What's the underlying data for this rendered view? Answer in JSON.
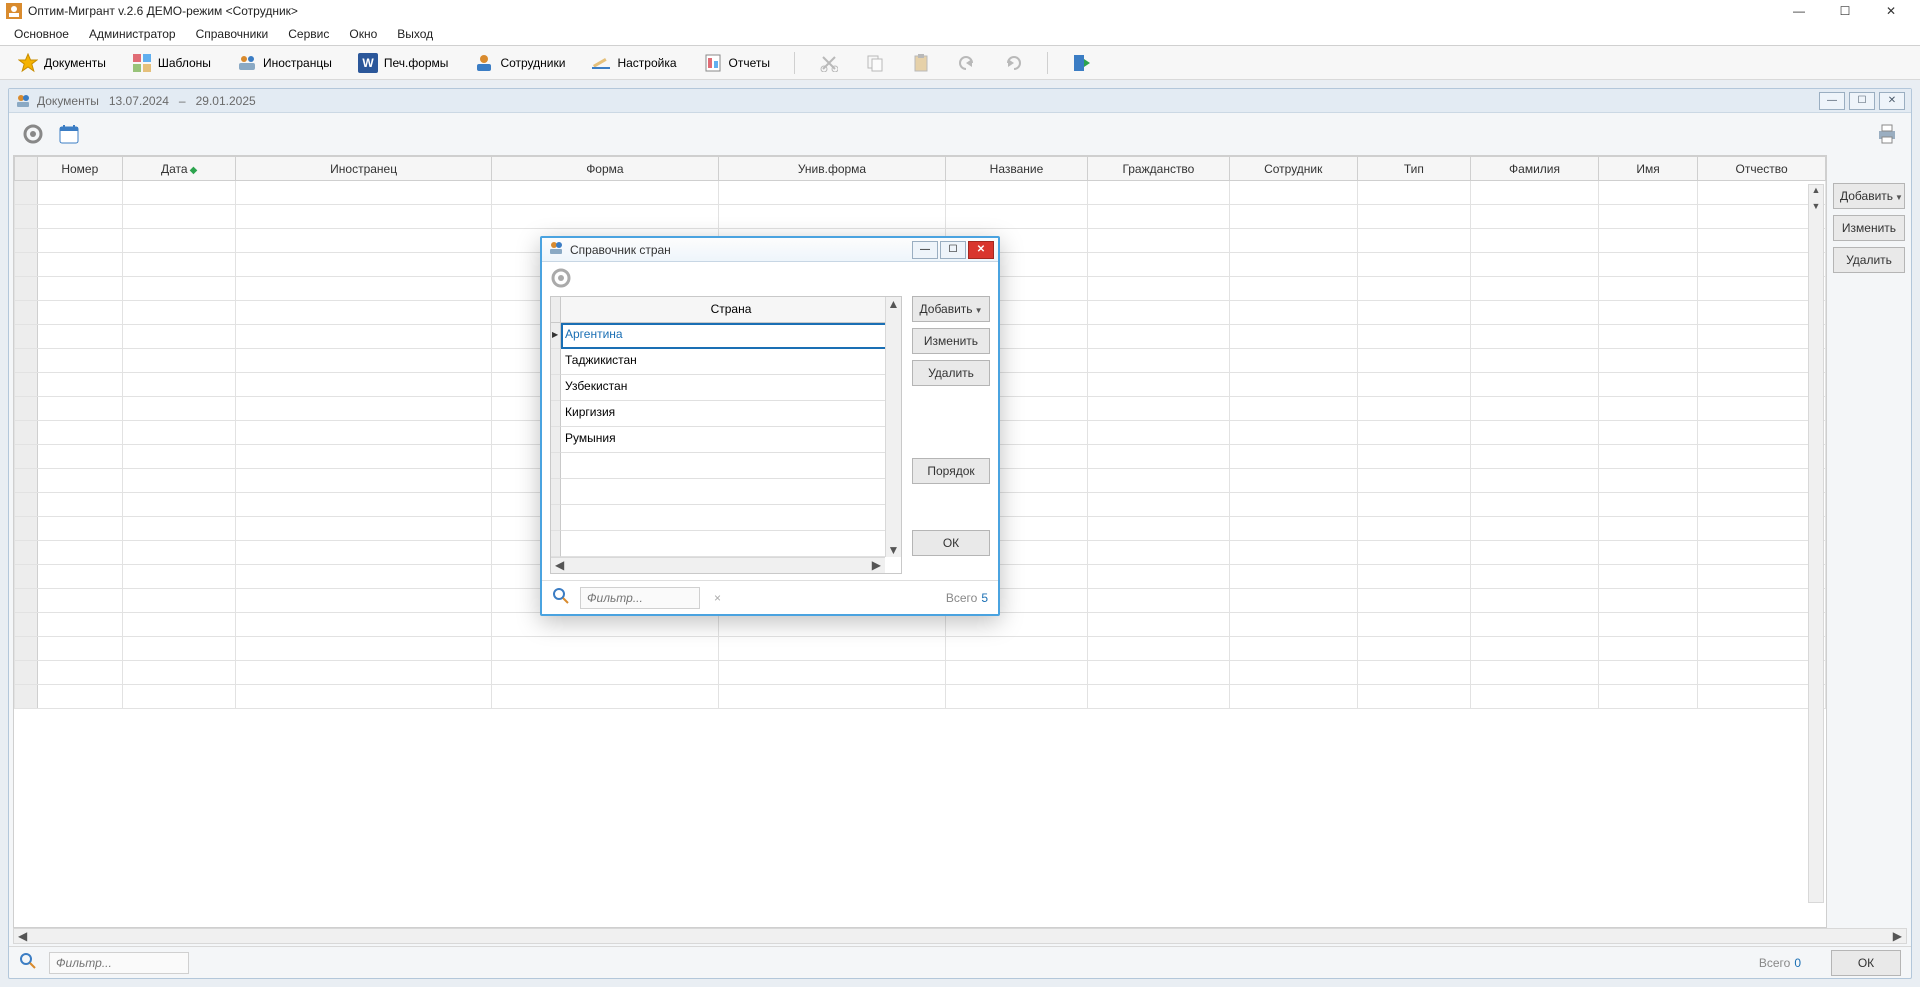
{
  "titlebar": {
    "app_title": "Оптим-Мигрант v.2.6   ДЕМО-режим   <Сотрудник>"
  },
  "menubar": [
    "Основное",
    "Администратор",
    "Справочники",
    "Сервис",
    "Окно",
    "Выход"
  ],
  "toolbar": {
    "items": [
      {
        "label": "Документы",
        "icon": "star"
      },
      {
        "label": "Шаблоны",
        "icon": "grid"
      },
      {
        "label": "Иностранцы",
        "icon": "people"
      },
      {
        "label": "Печ.формы",
        "icon": "word"
      },
      {
        "label": "Сотрудники",
        "icon": "user"
      },
      {
        "label": "Настройка",
        "icon": "pencil"
      },
      {
        "label": "Отчеты",
        "icon": "report"
      }
    ]
  },
  "docwin": {
    "title": "Документы",
    "date_from": "13.07.2024",
    "date_to": "29.01.2025",
    "columns": [
      "Номер",
      "Дата",
      "Иностранец",
      "Форма",
      "Унив.форма",
      "Название",
      "Гражданство",
      "Сотрудник",
      "Тип",
      "Фамилия",
      "Имя",
      "Отчество"
    ],
    "sort_col_index": 1,
    "buttons": {
      "add": "Добавить",
      "edit": "Изменить",
      "del": "Удалить",
      "ok": "ОК"
    },
    "filter_placeholder": "Фильтр...",
    "total_label": "Всего",
    "total_value": "0",
    "empty_rows": 22
  },
  "dialog": {
    "title": "Справочник стран",
    "column": "Страна",
    "rows": [
      "Аргентина",
      "Таджикистан",
      "Узбекистан",
      "Киргизия",
      "Румыния"
    ],
    "selected_index": 0,
    "extra_empty_rows": 4,
    "buttons": {
      "add": "Добавить",
      "edit": "Изменить",
      "del": "Удалить",
      "order": "Порядок",
      "ok": "ОК"
    },
    "filter_placeholder": "Фильтр...",
    "total_label": "Всего",
    "total_value": "5"
  }
}
